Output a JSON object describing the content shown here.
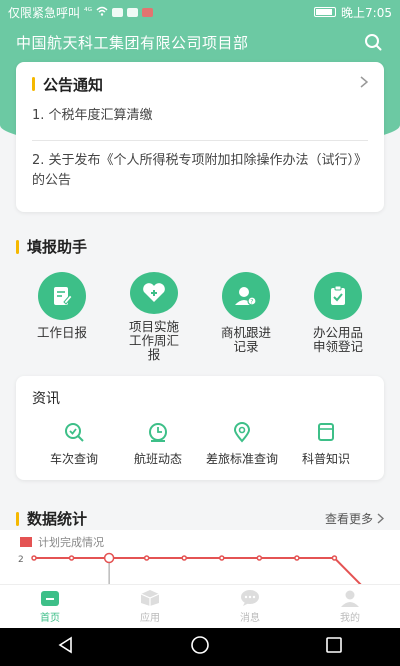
{
  "status_bar": {
    "carrier": "仅限紧急呼叫",
    "signal": "⁴ᴳ",
    "time": "晚上7:05"
  },
  "header": {
    "title": "中国航天科工集团有限公司项目部"
  },
  "notice": {
    "title": "公告通知",
    "items": [
      "1. 个税年度汇算清缴",
      "2. 关于发布《个人所得税专项附加扣除操作办法（试行）》的公告"
    ]
  },
  "helper": {
    "title": "填报助手",
    "items": [
      {
        "label": "工作日报",
        "icon": "edit-icon"
      },
      {
        "label": "项目实施工作周汇报",
        "icon": "heart-plus-icon"
      },
      {
        "label": "商机跟进记录",
        "icon": "user-question-icon"
      },
      {
        "label": "办公用品申领登记",
        "icon": "clipboard-icon"
      }
    ]
  },
  "info": {
    "title": "资讯",
    "items": [
      {
        "label": "车次查询",
        "icon": "search-check-icon"
      },
      {
        "label": "航班动态",
        "icon": "clock-icon"
      },
      {
        "label": "差旅标准查询",
        "icon": "location-pin-icon"
      },
      {
        "label": "科普知识",
        "icon": "book-icon"
      }
    ]
  },
  "stats": {
    "title": "数据统计",
    "more": "查看更多",
    "legend": "计划完成情况",
    "y_tick": "2"
  },
  "chart_data": {
    "type": "line",
    "series": [
      {
        "name": "计划完成情况",
        "values": [
          2,
          2,
          2,
          2,
          2,
          2,
          2,
          2,
          2,
          0
        ]
      }
    ],
    "yticks": [
      "2"
    ],
    "color": "#e45353"
  },
  "bottom_nav": {
    "items": [
      {
        "label": "首页",
        "active": true
      },
      {
        "label": "应用",
        "active": false
      },
      {
        "label": "消息",
        "active": false
      },
      {
        "label": "我的",
        "active": false
      }
    ]
  },
  "colors": {
    "primary_green": "#3dbf88",
    "header_green": "#6cc9a3",
    "accent_yellow": "#f5b800",
    "chart_red": "#e45353"
  }
}
